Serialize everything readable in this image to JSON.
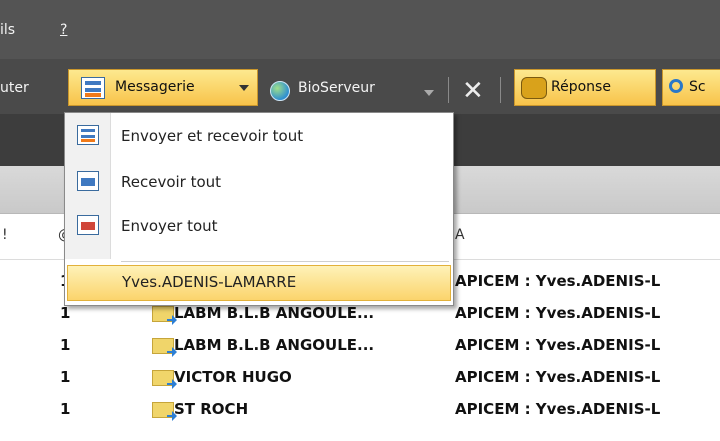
{
  "menubar": {
    "item_partial": "ils",
    "help": "?"
  },
  "toolbar": {
    "partial_left": "uter",
    "messagerie": "Messagerie",
    "bioserveur": "BioServeur",
    "reponse": "Réponse",
    "partial_right": "Sc"
  },
  "dropdown": {
    "items": [
      {
        "label": "Envoyer et recevoir tout",
        "icon": "send-receive-icon"
      },
      {
        "label": "Recevoir tout",
        "icon": "receive-icon"
      },
      {
        "label": "Envoyer tout",
        "icon": "send-icon"
      }
    ],
    "user": "Yves.ADENIS-LAMARRE"
  },
  "columns": {
    "col1": "!",
    "col2": "@",
    "col_to": "A"
  },
  "rows": [
    {
      "count": "1",
      "from": "",
      "to": "APICEM : Yves.ADENIS-L"
    },
    {
      "count": "1",
      "from": "LABM B.L.B ANGOULE...",
      "to": "APICEM : Yves.ADENIS-L"
    },
    {
      "count": "1",
      "from": "LABM B.L.B ANGOULE...",
      "to": "APICEM : Yves.ADENIS-L"
    },
    {
      "count": "1",
      "from": "VICTOR HUGO",
      "to": "APICEM : Yves.ADENIS-L"
    },
    {
      "count": "1",
      "from": "ST ROCH",
      "to": "APICEM : Yves.ADENIS-L"
    }
  ],
  "colors": {
    "accent": "#f8c34a",
    "toolbar_bg": "#4a4a4a",
    "menubar_bg": "#545454"
  }
}
